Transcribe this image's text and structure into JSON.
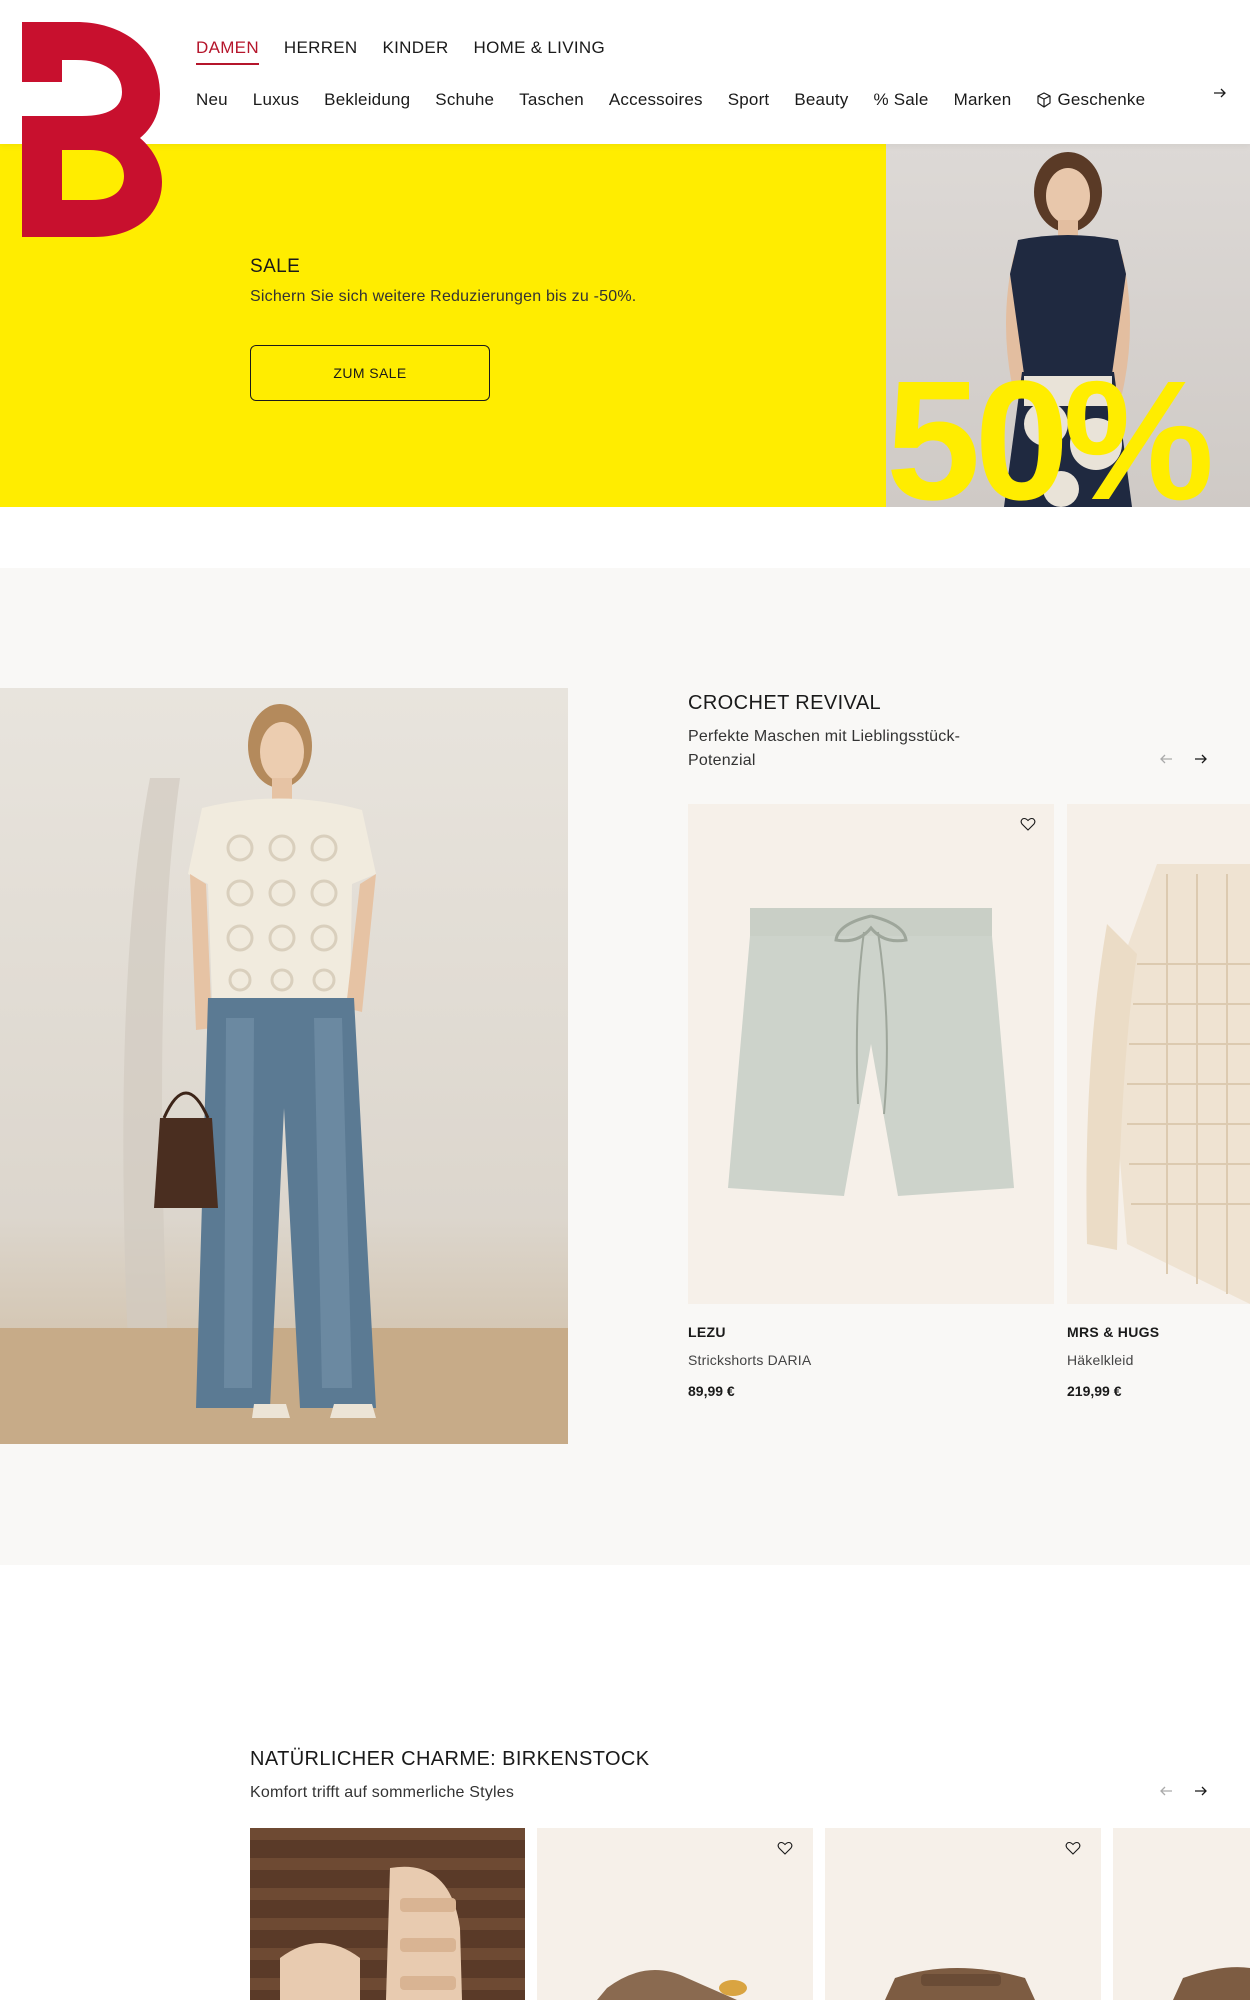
{
  "nav": {
    "top": [
      {
        "label": "DAMEN",
        "active": true
      },
      {
        "label": "HERREN",
        "active": false
      },
      {
        "label": "KINDER",
        "active": false
      },
      {
        "label": "HOME & LIVING",
        "active": false
      }
    ],
    "categories": [
      "Neu",
      "Luxus",
      "Bekleidung",
      "Schuhe",
      "Taschen",
      "Accessoires",
      "Sport",
      "Beauty",
      "% Sale",
      "Marken"
    ],
    "gift_label": "Geschenke",
    "icons": {
      "gift": "gift-box-icon",
      "next": "arrow-right-icon"
    }
  },
  "brand": {
    "logo_letter": "B",
    "logo_color": "#b5152b"
  },
  "hero": {
    "title": "SALE",
    "subtitle": "Sichern Sie sich weitere Reduzierungen bis zu -50%.",
    "button": "ZUM SALE",
    "big_text": "50%",
    "background": "#ffed00"
  },
  "crochet": {
    "title": "CROCHET REVIVAL",
    "subtitle_line1": "Perfekte Maschen mit Lieblingsstück-",
    "subtitle_line2": "Potenzial",
    "products": [
      {
        "brand": "LEZU",
        "name": "Strickshorts DARIA",
        "price": "89,99 €"
      },
      {
        "brand": "MRS & HUGS",
        "name": "Häkelkleid",
        "price": "219,99 €"
      }
    ]
  },
  "birkenstock": {
    "title": "NATÜRLICHER CHARME: BIRKENSTOCK",
    "subtitle": "Komfort trifft auf sommerliche Styles"
  }
}
